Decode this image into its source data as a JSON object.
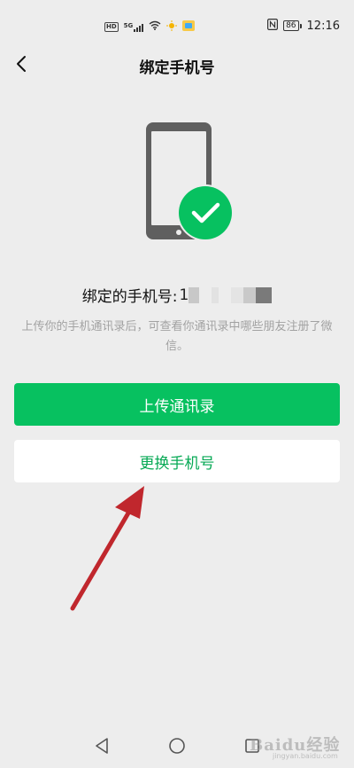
{
  "status_bar": {
    "hd_label": "HD",
    "network_label": "5G",
    "battery_level": "86",
    "time": "12:16"
  },
  "header": {
    "title": "绑定手机号"
  },
  "main": {
    "bound_label": "绑定的手机号:",
    "number_visible_prefix": "1",
    "description": "上传你的手机通讯录后，可查看你通讯录中哪些朋友注册了微信。",
    "upload_button_label": "上传通讯录",
    "change_button_label": "更换手机号"
  },
  "colors": {
    "primary_green": "#07c160",
    "background": "#ededed",
    "annotation_arrow": "#c0272d"
  },
  "icons": {
    "back": "back-arrow-icon",
    "illustration": "phone-check-illustration",
    "sys_back": "triangle-back-icon",
    "sys_home": "circle-home-icon",
    "sys_recent": "square-recent-icon"
  },
  "watermark": {
    "text": "Baidu经验",
    "sub": "jingyan.baidu.com"
  }
}
